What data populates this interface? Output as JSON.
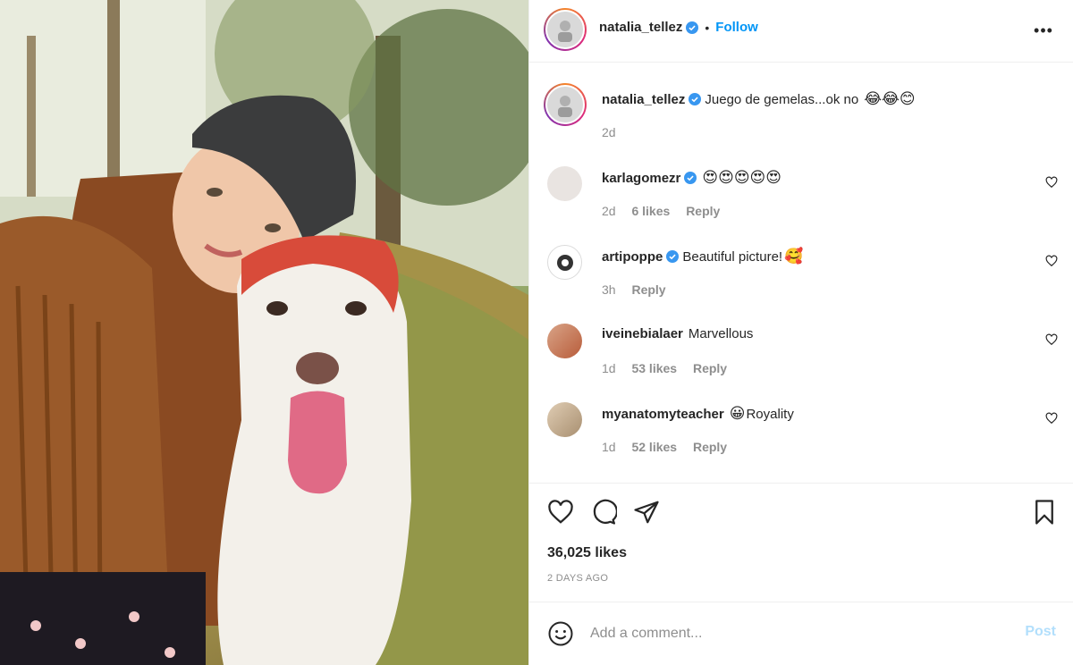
{
  "post": {
    "author": "natalia_tellez",
    "follow_label": "Follow",
    "separator": "•",
    "more_label": "•••"
  },
  "caption": {
    "username": "natalia_tellez",
    "text": "Juego de gemelas...ok no",
    "emojis": "😂😂😊",
    "time": "2d"
  },
  "comments": [
    {
      "username": "karlagomezr",
      "verified": true,
      "text": "",
      "emojis": "😍😍😍😍😍",
      "time": "2d",
      "likes": "6 likes",
      "reply": "Reply"
    },
    {
      "username": "artipoppe",
      "verified": true,
      "text": "Beautiful picture!",
      "emojis": "🥰",
      "time": "3h",
      "likes": "",
      "reply": "Reply"
    },
    {
      "username": "iveinebialaer",
      "verified": false,
      "text": "Marvellous",
      "emojis": "",
      "time": "1d",
      "likes": "53 likes",
      "reply": "Reply"
    },
    {
      "username": "myanatomyteacher",
      "verified": false,
      "text": "Royality",
      "emojis": "😀",
      "time": "1d",
      "likes": "52 likes",
      "reply": "Reply"
    }
  ],
  "stats": {
    "likes": "36,025 likes",
    "time_ago": "2 DAYS AGO"
  },
  "composer": {
    "placeholder": "Add a comment...",
    "post_label": "Post"
  },
  "icons": {
    "like": "heart-icon",
    "comment": "comment-icon",
    "share": "paper-plane-icon",
    "save": "bookmark-icon",
    "emoji": "smiley-icon",
    "verified": "verified-badge-icon"
  },
  "colors": {
    "accent": "#0095f6",
    "verified": "#3897f0",
    "post_disabled": "#b2dffc",
    "muted": "#8e8e8e"
  }
}
